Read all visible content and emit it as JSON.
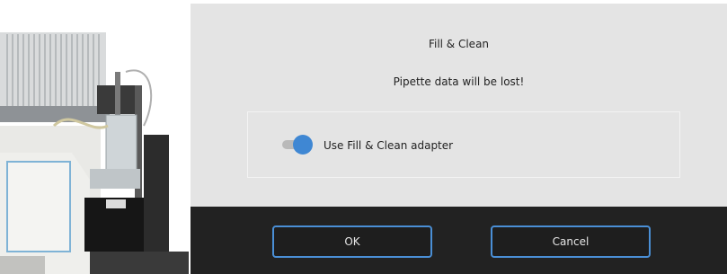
{
  "dialog": {
    "title": "Fill & Clean",
    "message": "Pipette data will be lost!",
    "option": {
      "label": "Use Fill & Clean adapter",
      "enabled": true
    },
    "buttons": {
      "ok_label": "OK",
      "cancel_label": "Cancel"
    }
  },
  "colors": {
    "dialog_bg": "#e4e4e4",
    "footer_bg": "#222222",
    "accent": "#3f87d3",
    "button_border": "#4a8fd6"
  }
}
